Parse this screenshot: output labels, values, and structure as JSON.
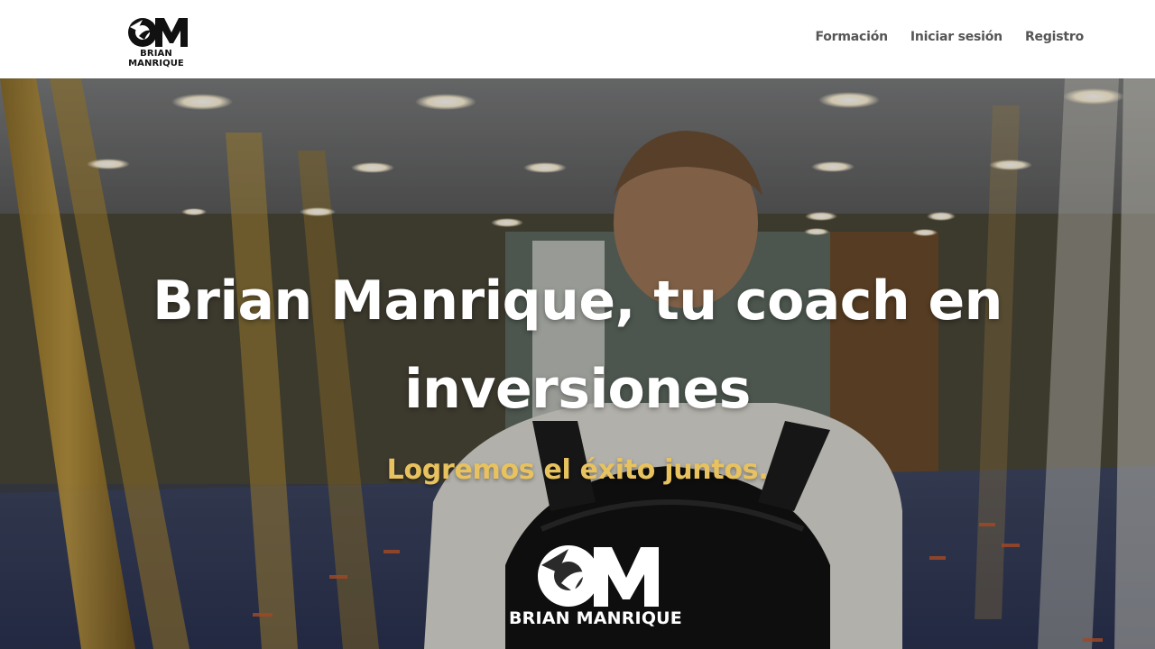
{
  "header": {
    "logo": {
      "icon": "om-monogram-logo",
      "text": "BRIAN MANRIQUE"
    },
    "nav": [
      {
        "label": "Formación"
      },
      {
        "label": "Iniciar sesión"
      },
      {
        "label": "Registro"
      }
    ]
  },
  "hero": {
    "title": "Brian Manrique, tu coach en inversiones",
    "subtitle": "Logremos el éxito juntos.",
    "logo": {
      "icon": "om-monogram-logo",
      "text": "BRIAN MANRIQUE"
    }
  },
  "colors": {
    "header_bg": "#ffffff",
    "nav_text": "#555555",
    "hero_title": "#ffffff",
    "hero_subtitle": "#e8c25f"
  }
}
